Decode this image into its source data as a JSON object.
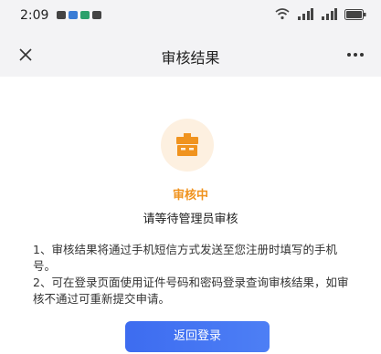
{
  "status_bar": {
    "time": "2:09",
    "notification_icons": [
      "message-icon",
      "chat-icon",
      "chat-icon",
      "app-icon"
    ],
    "right_icons": [
      "wifi-icon",
      "signal-icon",
      "signal-icon",
      "battery-icon"
    ]
  },
  "nav": {
    "title": "审核结果",
    "close_icon": "close-icon",
    "more_label": "···"
  },
  "result": {
    "status_label": "审核中",
    "status_sub": "请等待管理员审核",
    "accent_color": "#f0931e",
    "notes": [
      "1、审核结果将通过手机短信方式发送至您注册时填写的手机号。",
      "2、可在登录页面使用证件号码和密码登录查询审核结果，如审核不通过可重新提交申请。"
    ]
  },
  "actions": {
    "return_label": "返回登录",
    "button_color": "#3d6cf0"
  }
}
